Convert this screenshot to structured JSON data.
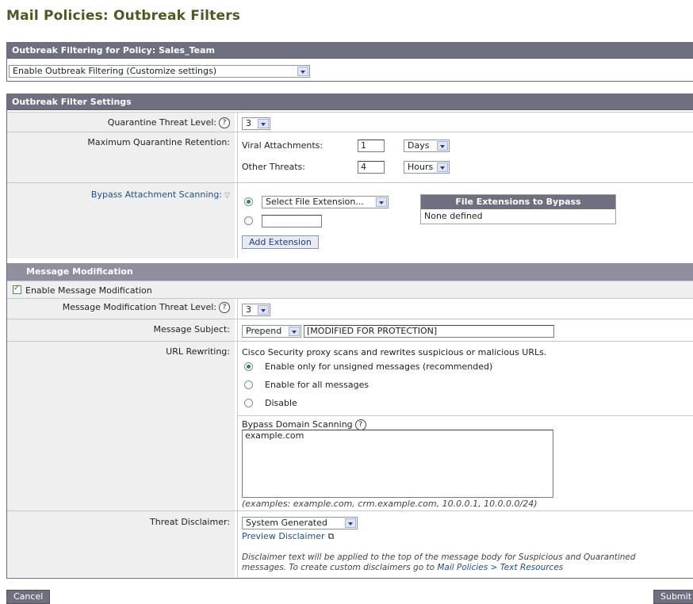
{
  "page_title": "Mail Policies: Outbreak Filters",
  "policy_panel": {
    "header": "Outbreak Filtering for Policy: Sales_Team",
    "mode_select": "Enable Outbreak Filtering (Customize settings)"
  },
  "settings_panel": {
    "header": "Outbreak Filter Settings",
    "quarantine_threat_level": {
      "label": "Quarantine Threat Level:",
      "value": "3"
    },
    "max_retention": {
      "label": "Maximum Quarantine Retention:",
      "viral_label": "Viral Attachments:",
      "viral_value": "1",
      "viral_unit": "Days",
      "other_label": "Other Threats:",
      "other_value": "4",
      "other_unit": "Hours"
    },
    "bypass_attachment": {
      "label": "Bypass Attachment Scanning:",
      "select_value": "Select File Extension...",
      "custom_value": "",
      "add_button": "Add Extension",
      "table_header": "File Extensions to Bypass",
      "table_empty": "None defined"
    }
  },
  "message_modification": {
    "header": "Message Modification",
    "enable_label": "Enable Message Modification",
    "threat_level": {
      "label": "Message Modification Threat Level:",
      "value": "3"
    },
    "subject": {
      "label": "Message Subject:",
      "mode": "Prepend",
      "text": "[MODIFIED FOR PROTECTION]"
    },
    "url_rewriting": {
      "label": "URL Rewriting:",
      "description": "Cisco Security proxy scans and rewrites suspicious or malicious URLs.",
      "options": [
        "Enable only for unsigned messages (recommended)",
        "Enable for all messages",
        "Disable"
      ],
      "bypass_label": "Bypass Domain Scanning",
      "bypass_value": "example.com",
      "bypass_examples": "(examples: example.com, crm.example.com, 10.0.0.1, 10.0.0.0/24)"
    },
    "threat_disclaimer": {
      "label": "Threat Disclaimer:",
      "value": "System Generated",
      "preview_link": "Preview Disclaimer",
      "note_line1": "Disclaimer text will be applied to the top of the message body for Suspicious and Quarantined",
      "note_line2_prefix": "messages. To create custom disclaimers go to ",
      "note_link": "Mail Policies > Text Resources"
    }
  },
  "actions": {
    "cancel": "Cancel",
    "submit": "Submit"
  },
  "colors": {
    "header_bg": "#6f6f80",
    "title": "#4b5a23",
    "link": "#1f4f8a",
    "label_bg": "#efefef"
  }
}
